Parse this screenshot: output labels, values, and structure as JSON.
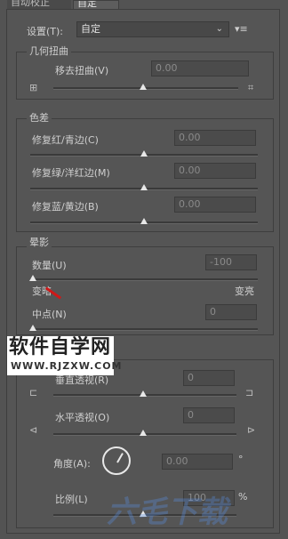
{
  "tabs": [
    {
      "label": "自动校正"
    },
    {
      "label": "自定"
    }
  ],
  "settings": {
    "label": "设置(T):",
    "value": "自定"
  },
  "geometric": {
    "title": "几何扭曲",
    "distortion_label": "移去扭曲(V)",
    "distortion_value": "0.00",
    "distortion_level": 0.5
  },
  "chromatic": {
    "title": "色差",
    "fix_red_cyan_label": "修复红/青边(C)",
    "fix_red_cyan_value": "0.00",
    "fix_green_magenta_label": "修复绿/洋红边(M)",
    "fix_green_magenta_value": "0.00",
    "fix_blue_yellow_label": "修复蓝/黄边(B)",
    "fix_blue_yellow_value": "0.00"
  },
  "vignette": {
    "title": "晕影",
    "amount_label": "数量(U)",
    "amount_value": "-100",
    "darken_label": "变暗",
    "lighten_label": "变亮",
    "midpoint_label": "中点(N)",
    "midpoint_value": "0"
  },
  "transform": {
    "vertical_label": "垂直透视(R)",
    "vertical_value": "0",
    "horizontal_label": "水平透视(O)",
    "horizontal_value": "0",
    "angle_label": "角度(A):",
    "angle_value": "0.00",
    "angle_unit": "°",
    "scale_label": "比例(L)",
    "scale_value": "100",
    "scale_unit": "%"
  },
  "watermark": {
    "big": "软件自学网",
    "small": "WWW.RJZXW.COM",
    "overlay": "六毛下载"
  }
}
